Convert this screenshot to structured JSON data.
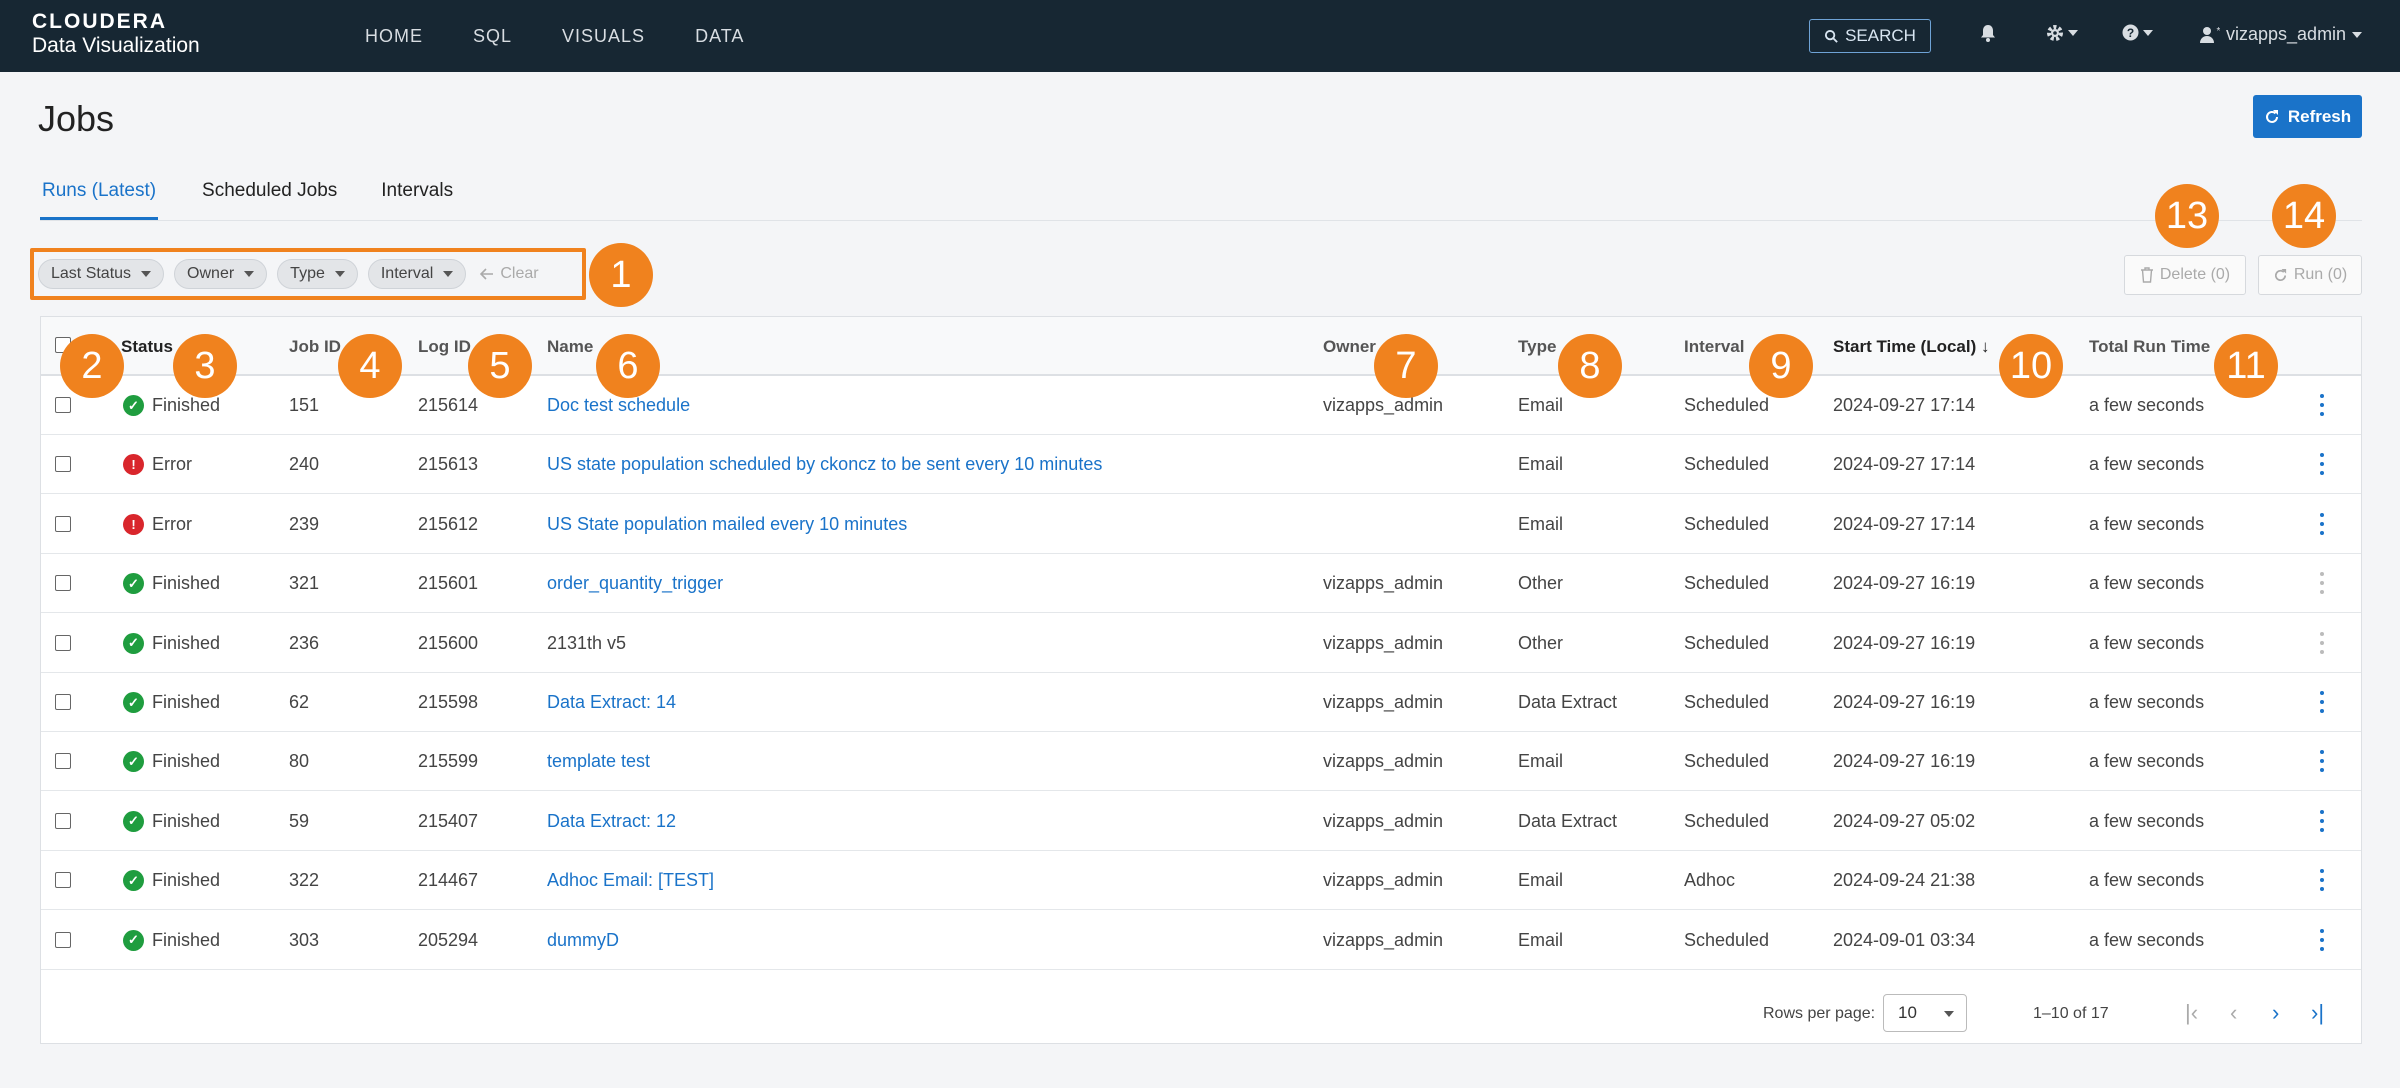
{
  "brand": {
    "line1": "CLOUDERA",
    "line2": "Data Visualization"
  },
  "nav": {
    "items": [
      "HOME",
      "SQL",
      "VISUALS",
      "DATA"
    ],
    "search_label": "SEARCH",
    "user": "vizapps_admin"
  },
  "page": {
    "title": "Jobs",
    "refresh_label": "Refresh"
  },
  "tabs": [
    "Runs (Latest)",
    "Scheduled Jobs",
    "Intervals"
  ],
  "filters": {
    "chips": [
      "Last Status",
      "Owner",
      "Type",
      "Interval"
    ],
    "clear_label": "Clear"
  },
  "actions": {
    "delete_label": "Delete (0)",
    "run_label": "Run (0)"
  },
  "markers": [
    "1",
    "2",
    "3",
    "4",
    "5",
    "6",
    "7",
    "8",
    "9",
    "10",
    "11",
    "13",
    "14"
  ],
  "table": {
    "headers": {
      "status": "Status",
      "job_id": "Job ID",
      "log_id": "Log ID",
      "name": "Name",
      "owner": "Owner",
      "type": "Type",
      "interval": "Interval",
      "start_time": "Start Time (Local) ↓",
      "total_run_time": "Total Run Time"
    },
    "rows": [
      {
        "status": "Finished",
        "ok": true,
        "job_id": "151",
        "log_id": "215614",
        "name": "Doc test schedule",
        "link": true,
        "owner": "vizapps_admin",
        "type": "Email",
        "interval": "Scheduled",
        "start": "2024-09-27 17:14",
        "run": "a few seconds",
        "dim": false
      },
      {
        "status": "Error",
        "ok": false,
        "job_id": "240",
        "log_id": "215613",
        "name": "US state population scheduled by ckoncz to be sent every 10 minutes",
        "link": true,
        "owner": "",
        "type": "Email",
        "interval": "Scheduled",
        "start": "2024-09-27 17:14",
        "run": "a few seconds",
        "dim": false
      },
      {
        "status": "Error",
        "ok": false,
        "job_id": "239",
        "log_id": "215612",
        "name": "US State population mailed every 10 minutes",
        "link": true,
        "owner": "",
        "type": "Email",
        "interval": "Scheduled",
        "start": "2024-09-27 17:14",
        "run": "a few seconds",
        "dim": false
      },
      {
        "status": "Finished",
        "ok": true,
        "job_id": "321",
        "log_id": "215601",
        "name": "order_quantity_trigger",
        "link": true,
        "owner": "vizapps_admin",
        "type": "Other",
        "interval": "Scheduled",
        "start": "2024-09-27 16:19",
        "run": "a few seconds",
        "dim": true
      },
      {
        "status": "Finished",
        "ok": true,
        "job_id": "236",
        "log_id": "215600",
        "name": "2131th v5",
        "link": false,
        "owner": "vizapps_admin",
        "type": "Other",
        "interval": "Scheduled",
        "start": "2024-09-27 16:19",
        "run": "a few seconds",
        "dim": true
      },
      {
        "status": "Finished",
        "ok": true,
        "job_id": "62",
        "log_id": "215598",
        "name": "Data Extract: 14",
        "link": true,
        "owner": "vizapps_admin",
        "type": "Data Extract",
        "interval": "Scheduled",
        "start": "2024-09-27 16:19",
        "run": "a few seconds",
        "dim": false
      },
      {
        "status": "Finished",
        "ok": true,
        "job_id": "80",
        "log_id": "215599",
        "name": "template test",
        "link": true,
        "owner": "vizapps_admin",
        "type": "Email",
        "interval": "Scheduled",
        "start": "2024-09-27 16:19",
        "run": "a few seconds",
        "dim": false
      },
      {
        "status": "Finished",
        "ok": true,
        "job_id": "59",
        "log_id": "215407",
        "name": "Data Extract: 12",
        "link": true,
        "owner": "vizapps_admin",
        "type": "Data Extract",
        "interval": "Scheduled",
        "start": "2024-09-27 05:02",
        "run": "a few seconds",
        "dim": false
      },
      {
        "status": "Finished",
        "ok": true,
        "job_id": "322",
        "log_id": "214467",
        "name": "Adhoc Email: [TEST]",
        "link": true,
        "owner": "vizapps_admin",
        "type": "Email",
        "interval": "Adhoc",
        "start": "2024-09-24 21:38",
        "run": "a few seconds",
        "dim": false
      },
      {
        "status": "Finished",
        "ok": true,
        "job_id": "303",
        "log_id": "205294",
        "name": "dummyD",
        "link": true,
        "owner": "vizapps_admin",
        "type": "Email",
        "interval": "Scheduled",
        "start": "2024-09-01 03:34",
        "run": "a few seconds",
        "dim": false
      }
    ]
  },
  "pagination": {
    "rows_label": "Rows per page:",
    "rows_value": "10",
    "range": "1–10 of 17"
  },
  "colors": {
    "accent": "#1a73c9",
    "marker": "#f0821e",
    "success": "#1f9d3f",
    "error": "#d9262c",
    "nav_bg": "#172733"
  }
}
